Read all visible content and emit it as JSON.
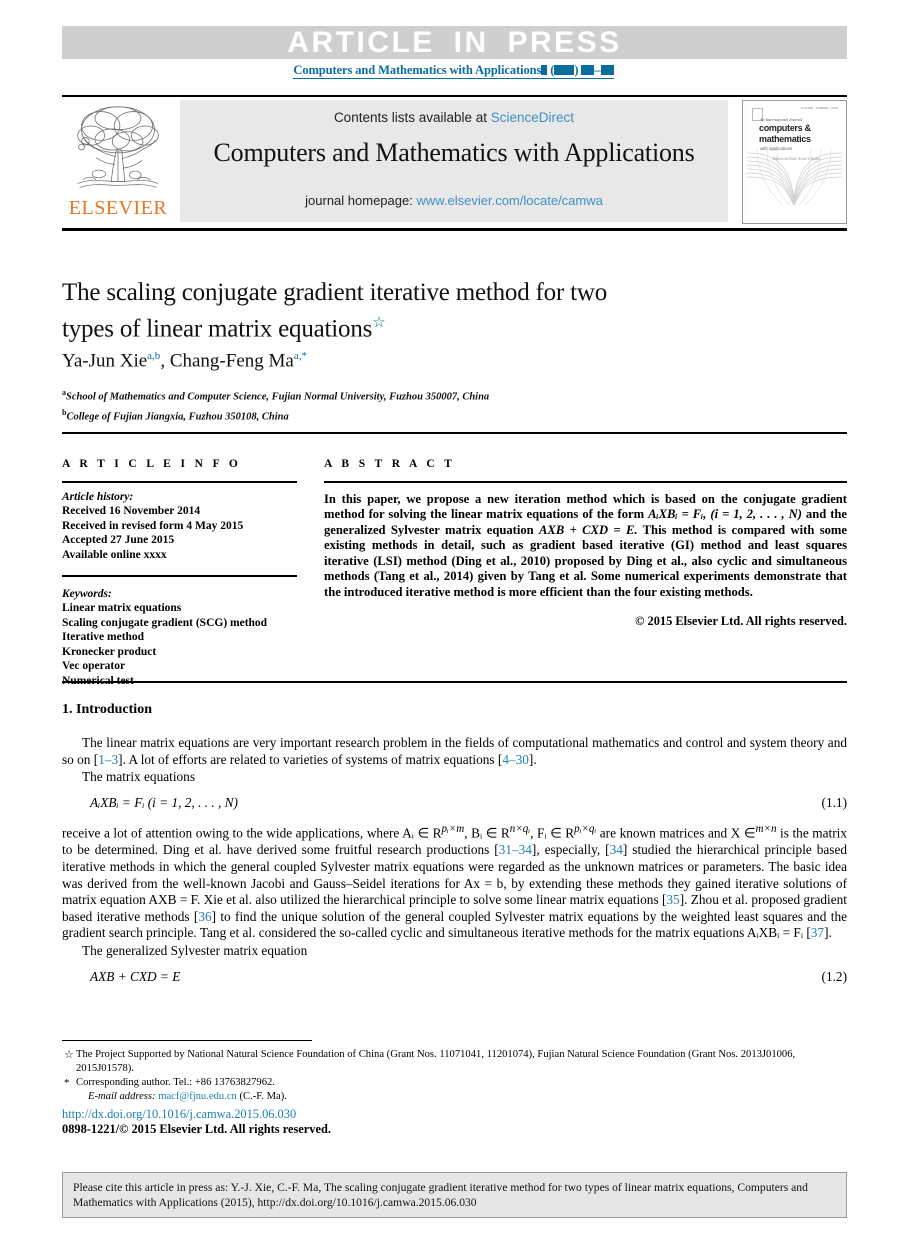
{
  "banner": {
    "text": "ARTICLE  IN  PRESS",
    "running_head": "Computers and Mathematics with Applications",
    "background": "#cfcfcf",
    "accent": "#0b6d9e"
  },
  "masthead": {
    "contents_prefix": "Contents lists available at ",
    "contents_link": "ScienceDirect",
    "journal_title": "Computers and Mathematics with Applications",
    "homepage_prefix": "journal homepage: ",
    "homepage_url": "www.elsevier.com/locate/camwa",
    "publisher": "ELSEVIER",
    "publisher_color": "#E87722",
    "cover": {
      "top_text": "VOLUME  ·  NUMBER  ·  ISSN",
      "superline": "An International Journal",
      "line1": "computers &",
      "line2": "mathematics",
      "line3": "with applications",
      "editor": "Editors-in-Chief: Ervin Y. Rodin"
    }
  },
  "article": {
    "title_line1": "The scaling conjugate gradient iterative method for two",
    "title_line2": "types of linear matrix equations",
    "title_star": "☆",
    "authors_part1": "Ya-Jun Xie",
    "authors_mark1": "a,b",
    "authors_sep": ", ",
    "authors_part2": "Chang-Feng Ma",
    "authors_mark2": "a,*",
    "affiliation_a_mark": "a",
    "affiliation_a": "School of Mathematics and Computer Science, Fujian Normal University, Fuzhou 350007, China",
    "affiliation_b_mark": "b",
    "affiliation_b": "College of Fujian Jiangxia, Fuzhou 350108, China"
  },
  "info": {
    "heading": "A R T I C L E   I N F O",
    "history_label": "Article history:",
    "history": [
      "Received 16 November 2014",
      "Received in revised form 4 May 2015",
      "Accepted 27 June 2015",
      "Available online xxxx"
    ],
    "keywords_label": "Keywords:",
    "keywords": [
      "Linear matrix equations",
      "Scaling conjugate gradient (SCG) method",
      "Iterative method",
      "Kronecker product",
      "Vec operator",
      "Numerical test"
    ]
  },
  "abstract": {
    "heading": "A B S T R A C T",
    "p1": "In this paper, we propose a new iteration method which is based on the conjugate gradient method for solving the linear matrix equations of the form ",
    "eq1": "AᵢXBᵢ = Fᵢ,  (i = 1, 2, . . . , N)",
    "p2": " and the generalized Sylvester matrix equation ",
    "eq2": "AXB + CXD = E.",
    "p3": " This method is compared with some existing methods in detail, such as gradient based iterative (GI) method and least squares iterative (LSI) method (Ding et al., 2010) proposed by Ding et al., also cyclic and simultaneous methods (Tang et al., 2014) given by Tang et al. Some numerical experiments demonstrate that the introduced iterative method is more efficient than the four existing methods.",
    "copyright": "© 2015 Elsevier Ltd. All rights reserved."
  },
  "body": {
    "section_number": "1.",
    "section_title": "Introduction",
    "para1_a": "The linear matrix equations are very important research problem in the fields of computational mathematics and control and system theory and so on [",
    "para1_cite1": "1–3",
    "para1_b": "]. A lot of efforts are related to varieties of systems of matrix equations [",
    "para1_cite2": "4–30",
    "para1_c": "].",
    "para2": "The matrix equations",
    "eq11_body": "AᵢXBᵢ = Fᵢ   (i = 1, 2, . . . , N)",
    "eq11_num": "(1.1)",
    "para3_a": "receive a lot of attention owing to the wide applications, where Aᵢ ∈ R",
    "para3_sup1": "pᵢ×m",
    "para3_b": ", Bᵢ ∈ R",
    "para3_sup2": "n×qᵢ",
    "para3_c": ", Fᵢ ∈ R",
    "para3_sup3": "pᵢ×qᵢ",
    "para3_d": " are known matrices and X ∈",
    "para3_sup4": "m×n",
    "para3_e": " is the matrix to be determined. Ding et al. have derived some fruitful research productions [",
    "para3_cite1": "31–34",
    "para3_f": "], especially, [",
    "para3_cite2": "34",
    "para3_g": "] studied the hierarchical principle based iterative methods in which the general coupled Sylvester matrix equations were regarded as the unknown matrices or parameters. The basic idea was derived from the well-known Jacobi and Gauss–Seidel iterations for Ax = b, by extending these methods they gained iterative solutions of matrix equation AXB = F. Xie et al. also utilized the hierarchical principle to solve some linear matrix equations [",
    "para3_cite3": "35",
    "para3_h": "]. Zhou et al. proposed gradient based iterative methods [",
    "para3_cite4": "36",
    "para3_i": "] to find the unique solution of the general coupled Sylvester matrix equations by the weighted least squares and the gradient search principle. Tang et al. considered the so-called cyclic and simultaneous iterative methods for the matrix equations AᵢXBᵢ = Fᵢ [",
    "para3_cite5": "37",
    "para3_j": "].",
    "para4": "The generalized Sylvester matrix equation",
    "eq12_body": "AXB + CXD = E",
    "eq12_num": "(1.2)"
  },
  "footnotes": {
    "fn1_mark": "☆",
    "fn1_text": "The Project Supported by National Natural Science Foundation of China (Grant Nos. 11071041, 11201074), Fujian Natural Science Foundation (Grant Nos. 2013J01006, 2015J01578).",
    "fn2_mark": "*",
    "fn2_text": "Corresponding author. Tel.: +86 13763827962.",
    "email_label": "E-mail address:",
    "email": "macf@fjnu.edu.cn",
    "email_suffix": " (C.-F. Ma).",
    "doi": "http://dx.doi.org/10.1016/j.camwa.2015.06.030",
    "issn": "0898-1221/© 2015 Elsevier Ltd. All rights reserved."
  },
  "cite_box": {
    "text": "Please cite this article in press as: Y.-J. Xie, C.-F. Ma, The scaling conjugate gradient iterative method for two types of linear matrix equations, Computers and Mathematics with Applications (2015), http://dx.doi.org/10.1016/j.camwa.2015.06.030"
  }
}
